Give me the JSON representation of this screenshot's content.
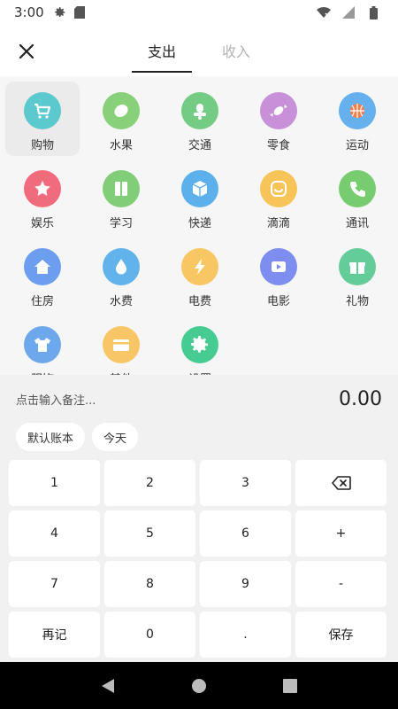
{
  "status_bar": {
    "time": "3:00"
  },
  "header": {
    "tabs": [
      {
        "label": "支出",
        "active": true
      },
      {
        "label": "收入",
        "active": false
      }
    ]
  },
  "categories": [
    {
      "label": "购物",
      "icon": "cart-icon",
      "color": "#5cc9cf",
      "selected": true
    },
    {
      "label": "水果",
      "icon": "lemon-icon",
      "color": "#88d07a"
    },
    {
      "label": "交通",
      "icon": "scooter-icon",
      "color": "#74cc84"
    },
    {
      "label": "零食",
      "icon": "candy-icon",
      "color": "#c890d8"
    },
    {
      "label": "运动",
      "icon": "basketball-icon",
      "color": "#66b0ee"
    },
    {
      "label": "娱乐",
      "icon": "star-icon",
      "color": "#f06c7c"
    },
    {
      "label": "学习",
      "icon": "book-icon",
      "color": "#82cd78"
    },
    {
      "label": "快递",
      "icon": "package-icon",
      "color": "#5cb0ec"
    },
    {
      "label": "滴滴",
      "icon": "didi-icon",
      "color": "#f7c45a"
    },
    {
      "label": "通讯",
      "icon": "phone-icon",
      "color": "#78cc70"
    },
    {
      "label": "住房",
      "icon": "house-icon",
      "color": "#6c9ef0"
    },
    {
      "label": "水费",
      "icon": "water-drop-icon",
      "color": "#62b2ec"
    },
    {
      "label": "电费",
      "icon": "lightning-icon",
      "color": "#f8c662"
    },
    {
      "label": "电影",
      "icon": "play-icon",
      "color": "#7e8df0"
    },
    {
      "label": "礼物",
      "icon": "gift-icon",
      "color": "#64cc98"
    },
    {
      "label": "服饰",
      "icon": "shirt-icon",
      "color": "#6ea8ec"
    },
    {
      "label": "其他",
      "icon": "card-icon",
      "color": "#f8c666"
    },
    {
      "label": "设置",
      "icon": "gear-icon",
      "color": "#46cc92"
    }
  ],
  "panel": {
    "memo_placeholder": "点击输入备注...",
    "amount": "0.00",
    "chips": [
      "默认账本",
      "今天"
    ]
  },
  "keypad": [
    {
      "label": "1"
    },
    {
      "label": "2"
    },
    {
      "label": "3"
    },
    {
      "label": "",
      "icon": "backspace-icon"
    },
    {
      "label": "4"
    },
    {
      "label": "5"
    },
    {
      "label": "6"
    },
    {
      "label": "+"
    },
    {
      "label": "7"
    },
    {
      "label": "8"
    },
    {
      "label": "9"
    },
    {
      "label": "-"
    },
    {
      "label": "再记"
    },
    {
      "label": "0"
    },
    {
      "label": "."
    },
    {
      "label": "保存"
    }
  ]
}
